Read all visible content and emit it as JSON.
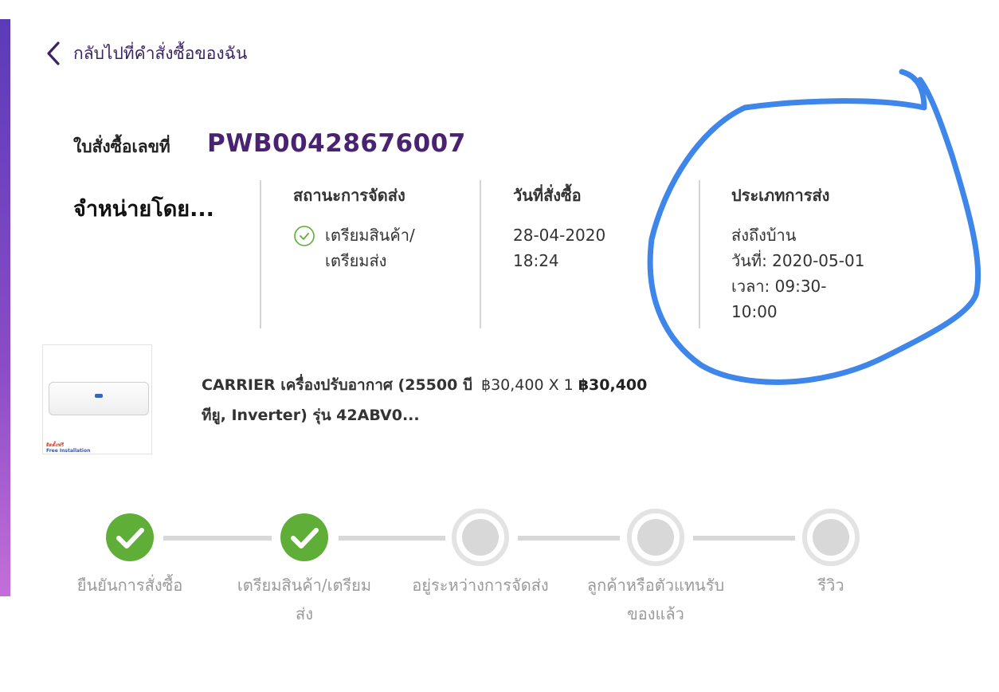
{
  "nav": {
    "back_label": "กลับไปที่คำสั่งซื้อของฉัน"
  },
  "order": {
    "label": "ใบสั่งซื้อเลขที่",
    "number": "PWB00428676007",
    "seller": "จำหน่ายโดย..."
  },
  "details": {
    "status": {
      "heading": "สถานะการจัดส่ง",
      "value": "เตรียมสินค้า/\nเตรียมส่ง"
    },
    "order_date": {
      "heading": "วันที่สั่งซื้อ",
      "value": "28-04-2020\n18:24"
    },
    "delivery_type": {
      "heading": "ประเภทการส่ง",
      "value": "ส่งถึงบ้าน\nวันที่: 2020-05-01\nเวลา: 09:30-\n10:00"
    }
  },
  "product": {
    "name": "CARRIER เครื่องปรับอากาศ (25500 บีทียู, Inverter) รุ่น 42ABV0...",
    "unit_price": "฿30,400",
    "qty_text": "X 1",
    "total": "฿30,400",
    "image_badge_line1": "ติดตั้งฟรี",
    "image_badge_line2": "Free Installation"
  },
  "progress": {
    "steps": [
      {
        "label": "ยืนยันการสั่งซื้อ",
        "done": true
      },
      {
        "label": "เตรียมสินค้า/เตรียม\nส่ง",
        "done": true
      },
      {
        "label": "อยู่ระหว่างการจัดส่ง",
        "done": false
      },
      {
        "label": "ลูกค้าหรือตัวแทนรับ\nของแล้ว",
        "done": false
      },
      {
        "label": "รีวิว",
        "done": false
      }
    ]
  },
  "colors": {
    "brand_purple": "#4a2272",
    "done_green": "#5fae38",
    "annotation_blue": "#3f86ea"
  }
}
